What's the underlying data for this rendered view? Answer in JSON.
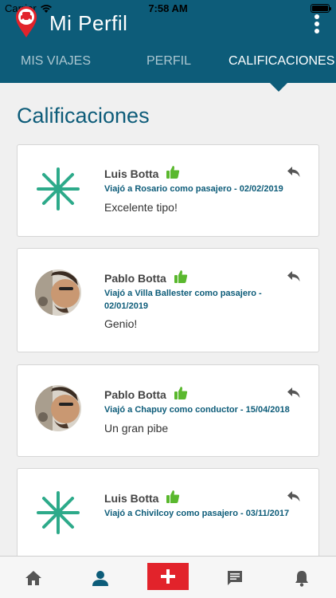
{
  "status": {
    "carrier": "Carrier",
    "time": "7:58 AM"
  },
  "header": {
    "title": "Mi Perfil"
  },
  "tabs": [
    {
      "label": "MIS VIAJES",
      "active": false
    },
    {
      "label": "PERFIL",
      "active": false
    },
    {
      "label": "CALIFICACIONES",
      "active": true
    }
  ],
  "section": {
    "title": "Calificaciones"
  },
  "colors": {
    "primary": "#0d5c79",
    "accent_green": "#2daa8a",
    "thumb_green": "#5ab82e",
    "add_red": "#e2232b"
  },
  "ratings": [
    {
      "name": "Luis Botta",
      "avatar": "asterisk-placeholder",
      "rating_icon": "thumbs-up-icon",
      "trip": "Viajó a Rosario como pasajero - 02/02/2019",
      "comment": "Excelente tipo!"
    },
    {
      "name": "Pablo Botta",
      "avatar": "user-photo",
      "rating_icon": "thumbs-up-icon",
      "trip": "Viajó a Villa Ballester como pasajero - 02/01/2019",
      "comment": "Genio!"
    },
    {
      "name": "Pablo Botta",
      "avatar": "user-photo",
      "rating_icon": "thumbs-up-icon",
      "trip": "Viajó a Chapuy como conductor - 15/04/2018",
      "comment": "Un gran pibe"
    },
    {
      "name": "Luis Botta",
      "avatar": "asterisk-placeholder",
      "rating_icon": "thumbs-up-icon",
      "trip": "Viajó a Chivilcoy como pasajero - 03/11/2017",
      "comment": ""
    }
  ],
  "bottom_nav": [
    "home-icon",
    "profile-icon",
    "add-icon",
    "messages-icon",
    "notifications-icon"
  ]
}
